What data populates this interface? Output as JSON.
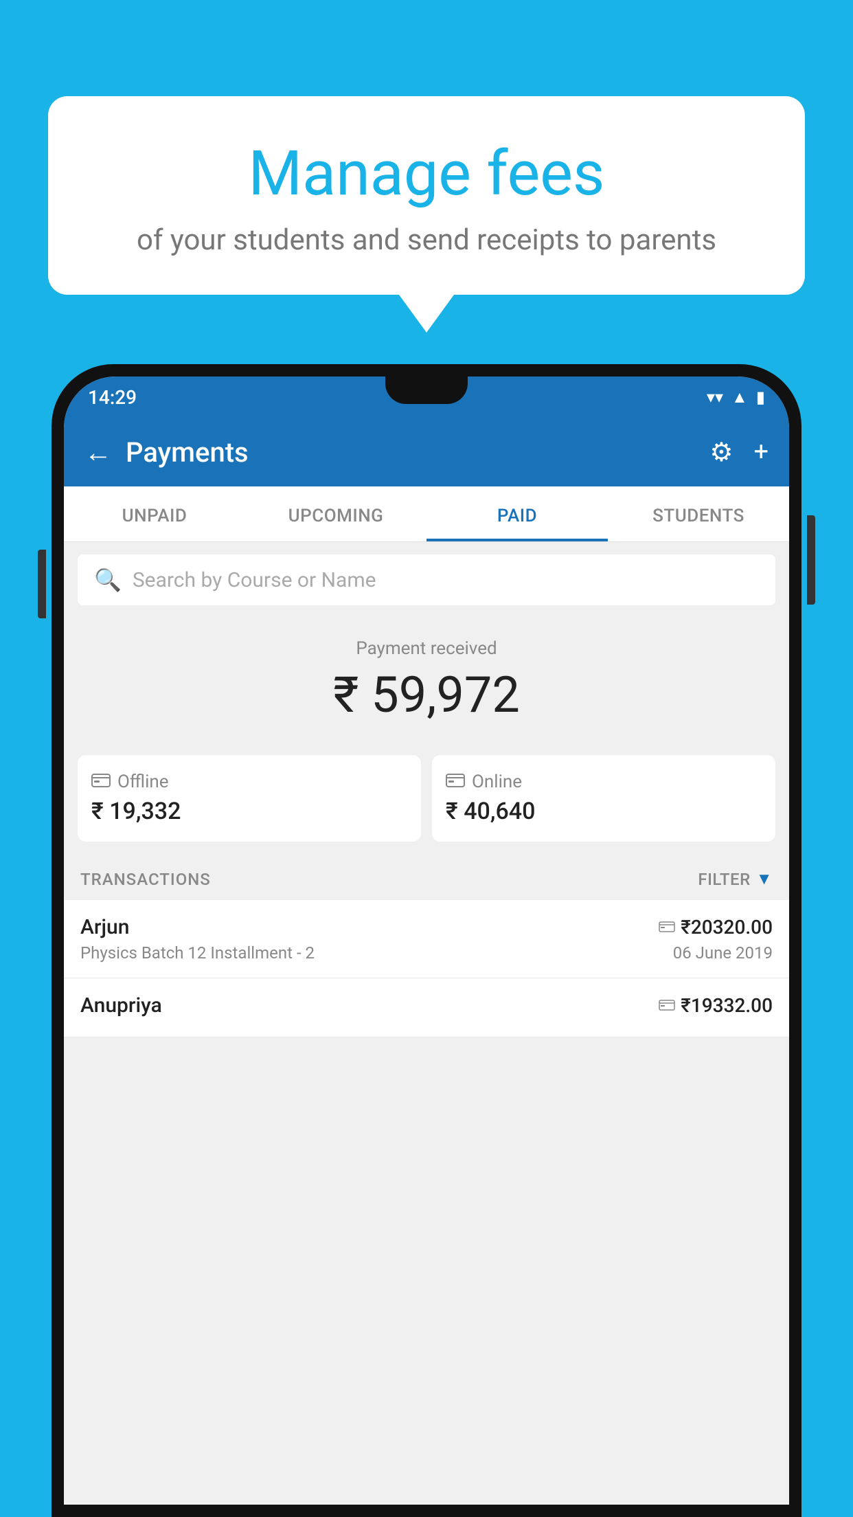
{
  "background_color": "#1ab3e8",
  "speech_bubble": {
    "title": "Manage fees",
    "subtitle": "of your students and send receipts to parents"
  },
  "status_bar": {
    "time": "14:29",
    "wifi_icon": "wifi",
    "signal_icon": "signal",
    "battery_icon": "battery"
  },
  "app_bar": {
    "title": "Payments",
    "back_label": "←",
    "settings_icon": "⚙",
    "add_icon": "+"
  },
  "tabs": [
    {
      "label": "UNPAID",
      "active": false
    },
    {
      "label": "UPCOMING",
      "active": false
    },
    {
      "label": "PAID",
      "active": true
    },
    {
      "label": "STUDENTS",
      "active": false
    }
  ],
  "search": {
    "placeholder": "Search by Course or Name"
  },
  "payment_summary": {
    "label": "Payment received",
    "amount": "₹ 59,972",
    "offline": {
      "icon": "💳",
      "label": "Offline",
      "amount": "₹ 19,332"
    },
    "online": {
      "icon": "💳",
      "label": "Online",
      "amount": "₹ 40,640"
    }
  },
  "transactions_section": {
    "label": "TRANSACTIONS",
    "filter_label": "FILTER"
  },
  "transactions": [
    {
      "name": "Arjun",
      "course": "Physics Batch 12 Installment - 2",
      "amount": "₹20320.00",
      "date": "06 June 2019",
      "payment_type": "online"
    },
    {
      "name": "Anupriya",
      "course": "",
      "amount": "₹19332.00",
      "date": "",
      "payment_type": "offline"
    }
  ]
}
